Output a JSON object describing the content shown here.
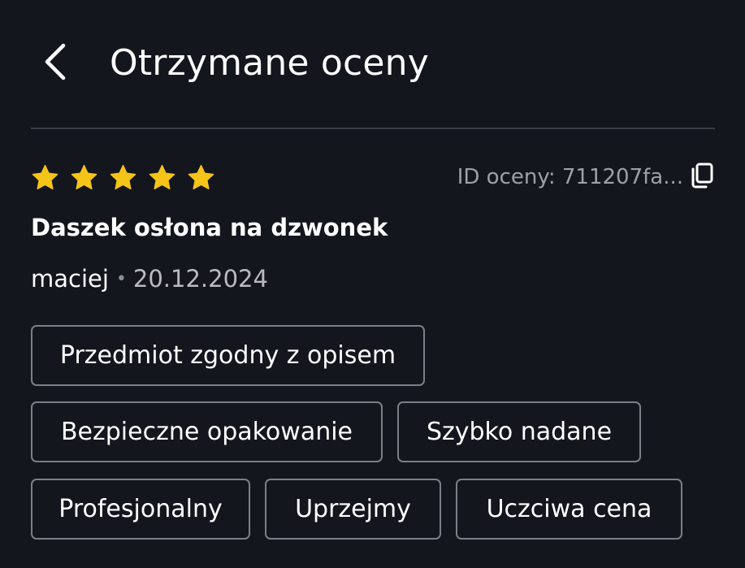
{
  "header": {
    "title": "Otrzymane oceny",
    "back_icon": "chevron-left-icon"
  },
  "rating": {
    "stars": 5,
    "max_stars": 5,
    "star_color": "#f5c419",
    "id_label": "ID oceny: 711207fa...",
    "copy_icon": "copy-icon"
  },
  "review": {
    "product_name": "Daszek osłona na dzwonek",
    "author": "maciej",
    "separator": "•",
    "date": "20.12.2024"
  },
  "tags": [
    "Przedmiot zgodny z opisem",
    "Bezpieczne opakowanie",
    "Szybko nadane",
    "Profesjonalny",
    "Uprzejmy",
    "Uczciwa cena"
  ],
  "colors": {
    "background": "#14161d",
    "divider": "#3a3d45",
    "tag_border": "#7c7f87",
    "muted_text": "#9ea0a7"
  }
}
